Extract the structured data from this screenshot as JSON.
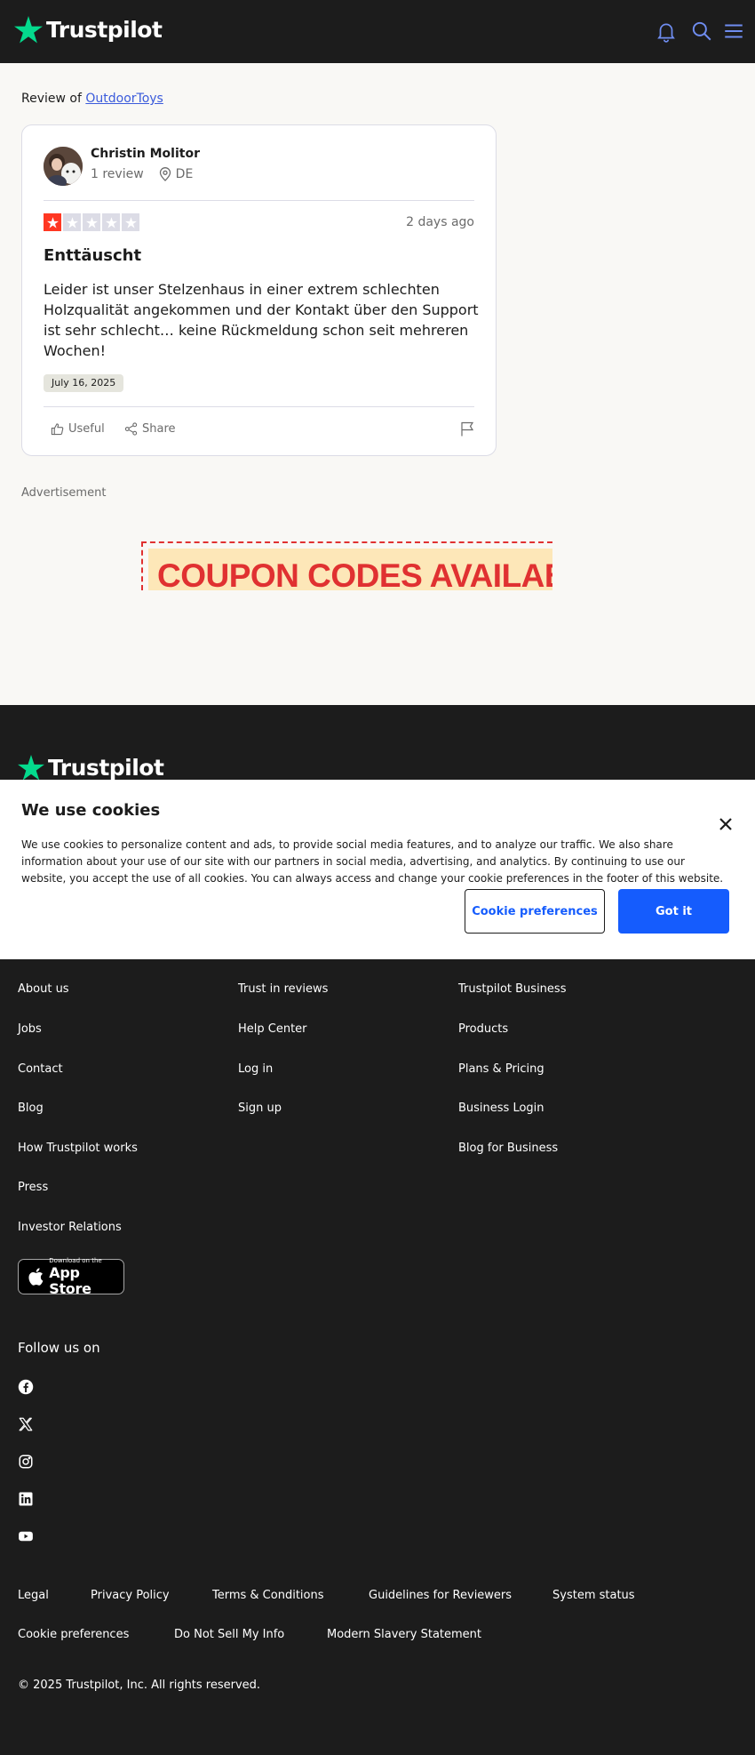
{
  "header": {
    "logo_text": "Trustpilot"
  },
  "main": {
    "review_of_prefix": "Review of",
    "company_name": "OutdoorToys"
  },
  "review": {
    "user_name": "Christin Molitor",
    "review_count": "1 review",
    "country": "DE",
    "rating": 1,
    "max_rating": 5,
    "relative_date": "2 days ago",
    "title": "Enttäuscht",
    "body": "Leider ist unser Stelzenhaus in einer extrem schlechten Holzqualität angekommen und der Kontakt über den Support ist sehr schlecht… keine Rückmeldung schon seit mehreren Wochen!",
    "experience_date": "July 16, 2025",
    "useful_label": "Useful",
    "share_label": "Share"
  },
  "ad": {
    "label": "Advertisement",
    "banner_text": "COUPON CODES AVAILABLE"
  },
  "footer_logo_text": "Trustpilot",
  "cookie_banner": {
    "title": "We use cookies",
    "text": "We use cookies to personalize content and ads, to provide social media features, and to analyze our traffic. We also share information about your use of our site with our partners in social media, advertising, and analytics. By continuing to use our website, you accept the use of all cookies. You can always access and change your cookie preferences in the footer of this website.",
    "preferences_button": "Cookie preferences",
    "accept_button": "Got it"
  },
  "footer": {
    "col1": [
      "About us",
      "Jobs",
      "Contact",
      "Blog",
      "How Trustpilot works",
      "Press",
      "Investor Relations"
    ],
    "col2": [
      "Trust in reviews",
      "Help Center",
      "Log in",
      "Sign up"
    ],
    "col3": [
      "Trustpilot Business",
      "Products",
      "Plans & Pricing",
      "Business Login",
      "Blog for Business"
    ],
    "app_store_small": "Download on the",
    "app_store_big": "App Store",
    "follow_label": "Follow us on",
    "social_icons": [
      "facebook-icon",
      "x-icon",
      "instagram-icon",
      "linkedin-icon",
      "youtube-icon"
    ],
    "legal_row1": [
      "Legal",
      "Privacy Policy",
      "Terms & Conditions",
      "Guidelines for Reviewers",
      "System status"
    ],
    "legal_row2": [
      "Cookie preferences",
      "Do Not Sell My Info",
      "Modern Slavery Statement"
    ],
    "copyright": "© 2025 Trustpilot, Inc. All rights reserved."
  },
  "colors": {
    "brand_green": "#04da8d",
    "star_red": "#ff3722",
    "star_empty": "#dcdce6",
    "primary_blue": "#155cfd",
    "dark_bg": "#1c1c1c"
  }
}
